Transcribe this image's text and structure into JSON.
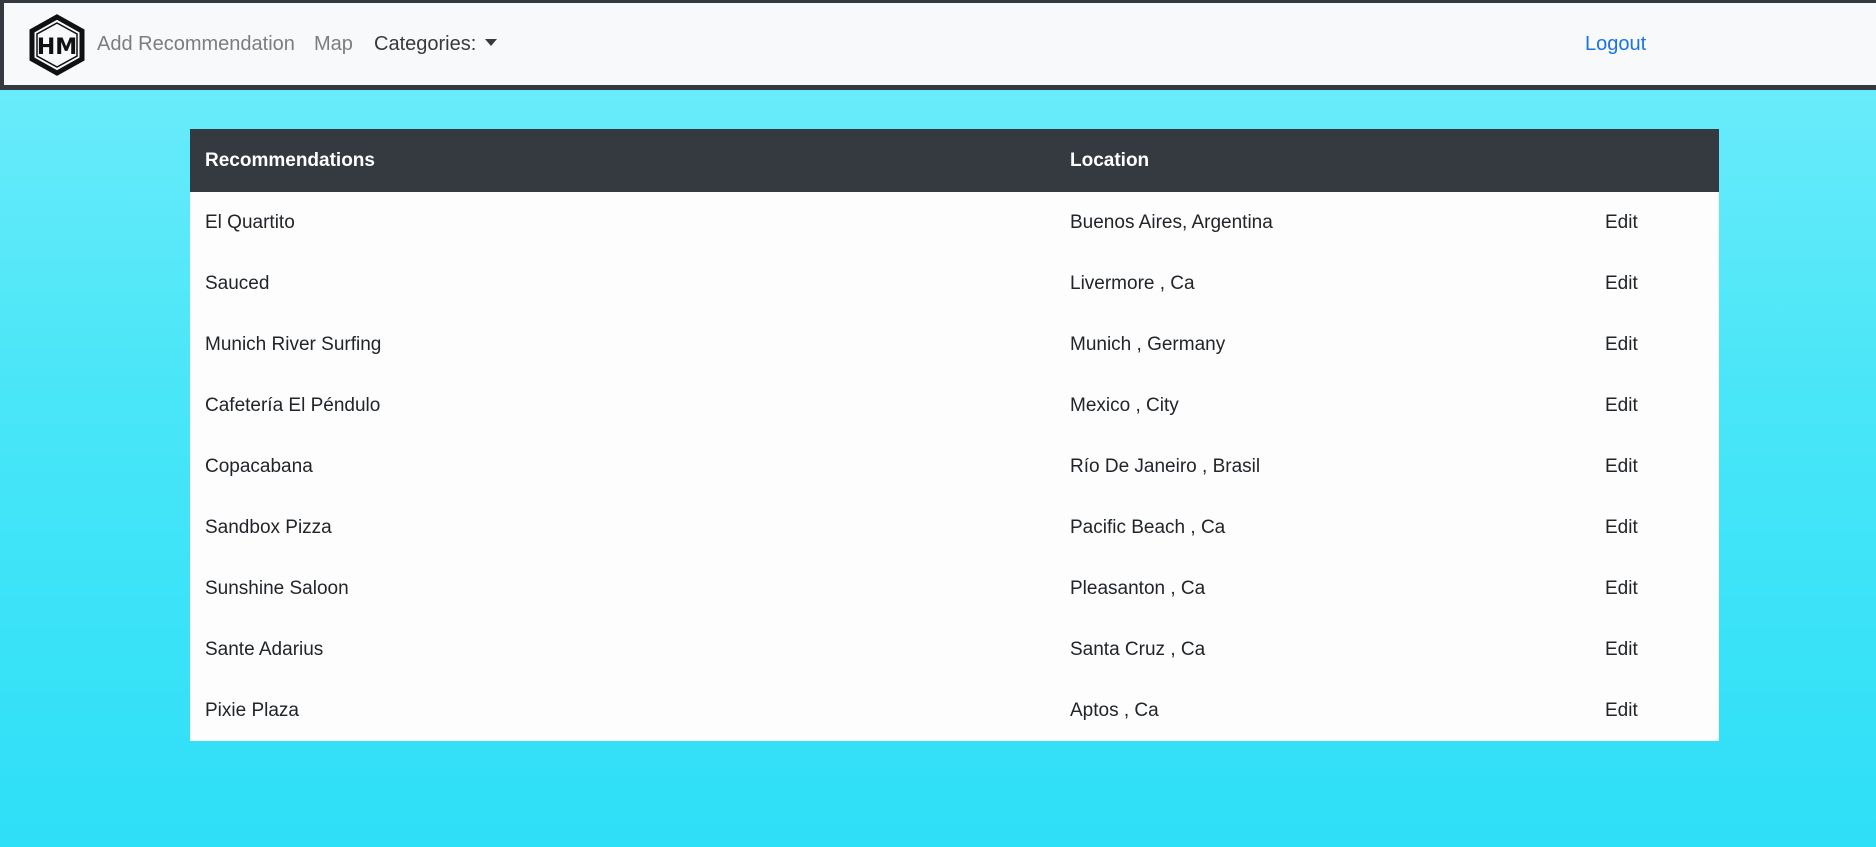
{
  "navbar": {
    "logo_text": "HM",
    "add_recommendation": "Add Recommendation",
    "map": "Map",
    "categories": "Categories:",
    "logout": "Logout"
  },
  "table": {
    "headers": [
      "Recommendations",
      "Location",
      ""
    ],
    "edit_label": "Edit",
    "rows": [
      {
        "name": "El Quartito",
        "location": "Buenos Aires, Argentina",
        "action": "Edit"
      },
      {
        "name": "Sauced",
        "location": "Livermore , Ca",
        "action": "Edit"
      },
      {
        "name": "Munich River Surfing",
        "location": "Munich , Germany",
        "action": "Edit"
      },
      {
        "name": "Cafetería El Péndulo",
        "location": "Mexico , City",
        "action": "Edit"
      },
      {
        "name": "Copacabana",
        "location": "Río De Janeiro , Brasil",
        "action": "Edit"
      },
      {
        "name": "Sandbox Pizza",
        "location": "Pacific Beach , Ca",
        "action": "Edit"
      },
      {
        "name": "Sunshine Saloon",
        "location": "Pleasanton , Ca",
        "action": "Edit"
      },
      {
        "name": "Sante Adarius",
        "location": "Santa Cruz , Ca",
        "action": "Edit"
      },
      {
        "name": "Pixie Plaza",
        "location": "Aptos , Ca",
        "action": "Edit"
      }
    ]
  },
  "colors": {
    "navbar_bg": "#f8f9fa",
    "table_header_bg": "#343a40",
    "logout_link": "#1a73e8",
    "page_bg_top": "#72edfb",
    "page_bg_bottom": "#2ddff7"
  },
  "icons": {
    "logo": "hm-hexagon-logo-icon",
    "categories_caret": "caret-down-icon"
  }
}
